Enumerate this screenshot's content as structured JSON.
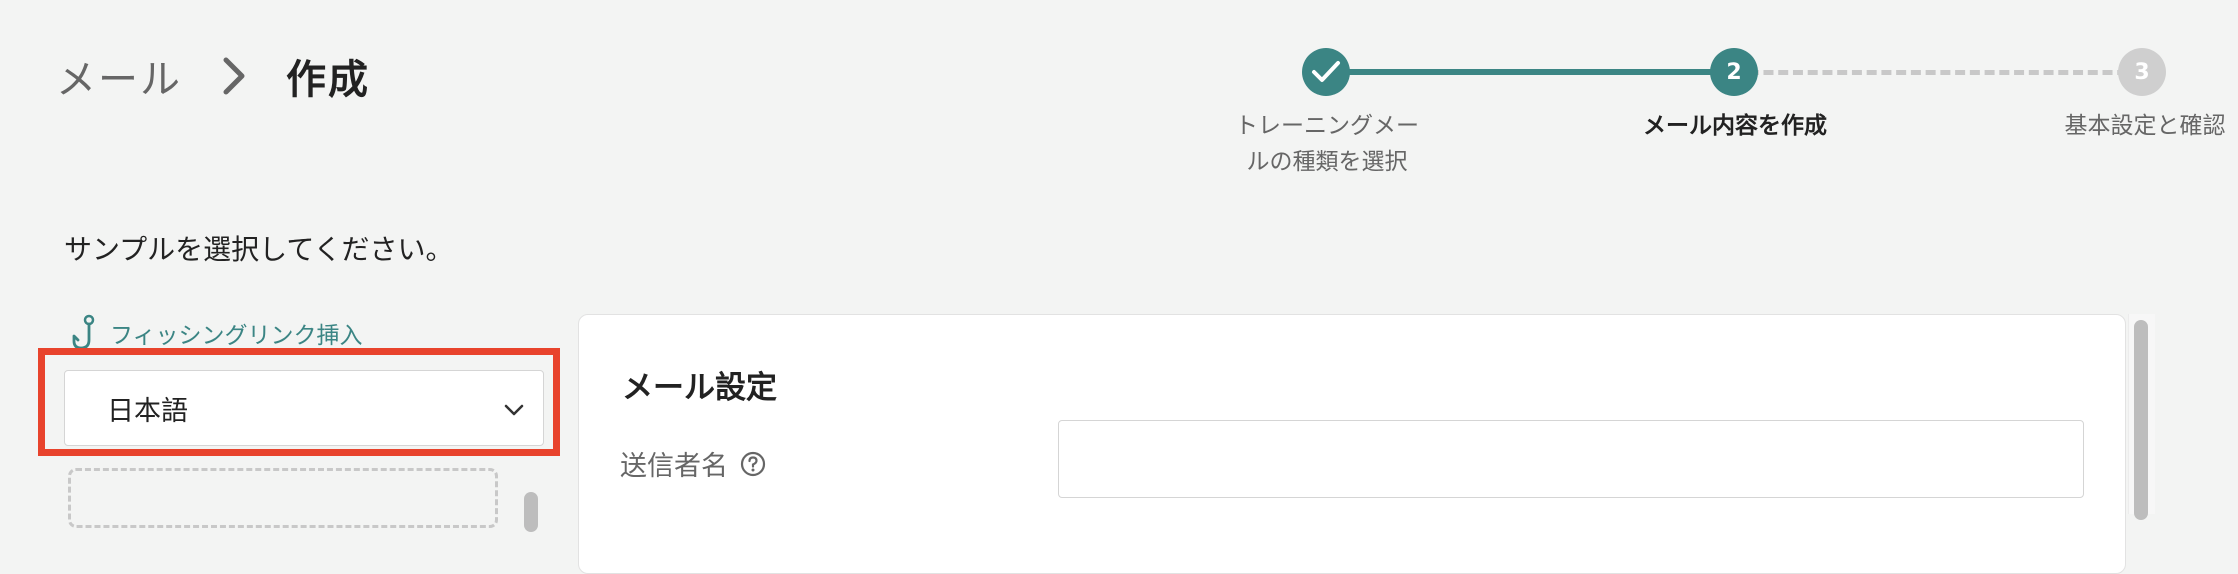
{
  "breadcrumb": {
    "parent": "メール",
    "current": "作成",
    "separator_icon": "chevron-right-icon"
  },
  "stepper": {
    "steps": [
      {
        "number": "1",
        "label_line1": "トレーニングメー",
        "label_line2": "ルの種類を選択",
        "state": "done",
        "icon": "check-icon"
      },
      {
        "number": "2",
        "label": "メール内容を作成",
        "state": "current"
      },
      {
        "number": "3",
        "label": "基本設定と確認",
        "state": "todo"
      }
    ]
  },
  "instruction": "サンプルを選択してください。",
  "phishing_link": {
    "label": "フィッシングリンク挿入",
    "icon": "hook-icon"
  },
  "language_select": {
    "value": "日本語",
    "icon": "chevron-down-icon"
  },
  "mail_settings": {
    "title": "メール設定",
    "sender_name_label": "送信者名",
    "sender_name_value": "",
    "help_icon": "question-circle-icon"
  },
  "colors": {
    "accent": "#3b8584",
    "highlight": "#e8432c",
    "inactive_step": "#cfcfcf",
    "background": "#f3f4f3"
  }
}
